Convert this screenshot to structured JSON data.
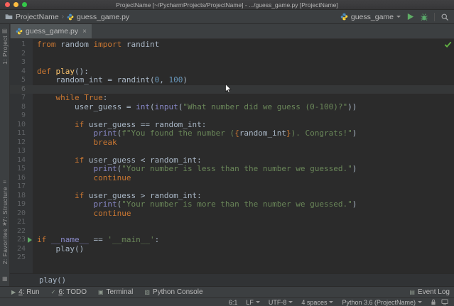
{
  "window": {
    "title": "ProjectName [~/PycharmProjects/ProjectName] - .../guess_game.py [ProjectName]"
  },
  "navbar": {
    "project": "ProjectName",
    "separator": "›",
    "file": "guess_game.py",
    "run_config": "guess_game"
  },
  "tabs": [
    {
      "label": "guess_game.py",
      "close": "×"
    }
  ],
  "left_strip": {
    "items": [
      {
        "id": "project",
        "label": "1: Project",
        "icon": "project-icon",
        "glyph": "▤"
      },
      {
        "id": "structure",
        "label": "7: Structure",
        "icon": "structure-icon",
        "glyph": "≡"
      },
      {
        "id": "favorites",
        "label": "2: Favorites",
        "icon": "favorites-icon",
        "glyph": "★"
      }
    ],
    "switcher_glyph": "▦"
  },
  "editor": {
    "caret_line": 6,
    "run_line": 23,
    "lines": [
      {
        "n": 1,
        "seg": [
          [
            "kw",
            "from"
          ],
          [
            "t",
            " random "
          ],
          [
            "kw",
            "import"
          ],
          [
            "t",
            " randint"
          ]
        ]
      },
      {
        "n": 2,
        "seg": []
      },
      {
        "n": 3,
        "seg": []
      },
      {
        "n": 4,
        "seg": [
          [
            "kw",
            "def"
          ],
          [
            "t",
            " "
          ],
          [
            "fn",
            "play"
          ],
          [
            "t",
            "():"
          ]
        ]
      },
      {
        "n": 5,
        "seg": [
          [
            "t",
            "    random_int = randint("
          ],
          [
            "nu",
            "0"
          ],
          [
            "t",
            ", "
          ],
          [
            "nu",
            "100"
          ],
          [
            "t",
            ")"
          ]
        ]
      },
      {
        "n": 6,
        "seg": []
      },
      {
        "n": 7,
        "seg": [
          [
            "t",
            "    "
          ],
          [
            "kw",
            "while"
          ],
          [
            "t",
            " "
          ],
          [
            "kw",
            "True"
          ],
          [
            "t",
            ":"
          ]
        ]
      },
      {
        "n": 8,
        "seg": [
          [
            "t",
            "        user_guess = "
          ],
          [
            "bi",
            "int"
          ],
          [
            "t",
            "("
          ],
          [
            "bi",
            "input"
          ],
          [
            "t",
            "("
          ],
          [
            "st",
            "\"What number did we guess (0-100)?\""
          ],
          [
            "t",
            "))"
          ]
        ]
      },
      {
        "n": 9,
        "seg": []
      },
      {
        "n": 10,
        "seg": [
          [
            "t",
            "        "
          ],
          [
            "kw",
            "if"
          ],
          [
            "t",
            " user_guess == random_int:"
          ]
        ]
      },
      {
        "n": 11,
        "seg": [
          [
            "t",
            "            "
          ],
          [
            "bi",
            "print"
          ],
          [
            "t",
            "("
          ],
          [
            "st",
            "f\"You found the number ("
          ],
          [
            "br",
            "{"
          ],
          [
            "t",
            "random_int"
          ],
          [
            "br",
            "}"
          ],
          [
            "st",
            "). Congrats!\""
          ],
          [
            "t",
            ")"
          ]
        ]
      },
      {
        "n": 12,
        "seg": [
          [
            "t",
            "            "
          ],
          [
            "kw",
            "break"
          ]
        ]
      },
      {
        "n": 13,
        "seg": []
      },
      {
        "n": 14,
        "seg": [
          [
            "t",
            "        "
          ],
          [
            "kw",
            "if"
          ],
          [
            "t",
            " user_guess < random_int:"
          ]
        ]
      },
      {
        "n": 15,
        "seg": [
          [
            "t",
            "            "
          ],
          [
            "bi",
            "print"
          ],
          [
            "t",
            "("
          ],
          [
            "st",
            "\"Your number is less than the number we guessed.\""
          ],
          [
            "t",
            ")"
          ]
        ]
      },
      {
        "n": 16,
        "seg": [
          [
            "t",
            "            "
          ],
          [
            "kw",
            "continue"
          ]
        ]
      },
      {
        "n": 17,
        "seg": []
      },
      {
        "n": 18,
        "seg": [
          [
            "t",
            "        "
          ],
          [
            "kw",
            "if"
          ],
          [
            "t",
            " user_guess > random_int:"
          ]
        ]
      },
      {
        "n": 19,
        "seg": [
          [
            "t",
            "            "
          ],
          [
            "bi",
            "print"
          ],
          [
            "t",
            "("
          ],
          [
            "st",
            "\"Your number is more than the number we guessed.\""
          ],
          [
            "t",
            ")"
          ]
        ]
      },
      {
        "n": 20,
        "seg": [
          [
            "t",
            "            "
          ],
          [
            "kw",
            "continue"
          ]
        ]
      },
      {
        "n": 21,
        "seg": []
      },
      {
        "n": 22,
        "seg": []
      },
      {
        "n": 23,
        "seg": [
          [
            "kw",
            "if"
          ],
          [
            "t",
            " "
          ],
          [
            "bi",
            "__name__"
          ],
          [
            "t",
            " == "
          ],
          [
            "st",
            "'__main__'"
          ],
          [
            "t",
            ":"
          ]
        ]
      },
      {
        "n": 24,
        "seg": [
          [
            "t",
            "    play()"
          ]
        ]
      },
      {
        "n": 25,
        "seg": []
      }
    ]
  },
  "breadcrumbs": {
    "context": "play()"
  },
  "toolbar": {
    "left": [
      {
        "id": "run",
        "mnemonic": "4",
        "rest": ": Run",
        "icon": "run-tool-icon",
        "glyph": "▶"
      },
      {
        "id": "todo",
        "mnemonic": "6",
        "rest": ": TODO",
        "icon": "todo-tool-icon",
        "glyph": "✓"
      },
      {
        "id": "terminal",
        "mnemonic": "",
        "rest": "Terminal",
        "icon": "terminal-tool-icon",
        "glyph": "▣"
      },
      {
        "id": "python-console",
        "mnemonic": "",
        "rest": "Python Console",
        "icon": "python-console-icon",
        "glyph": "▧"
      }
    ],
    "right": [
      {
        "id": "event-log",
        "mnemonic": "",
        "rest": "Event Log",
        "icon": "event-log-icon",
        "glyph": "▤"
      }
    ]
  },
  "statusbar": {
    "items": [
      {
        "label": "6:1",
        "caret": false
      },
      {
        "label": "LF",
        "caret": true
      },
      {
        "label": "UTF-8",
        "caret": true
      },
      {
        "label": "4 spaces",
        "caret": true
      },
      {
        "label": "Python 3.6 (ProjectName)",
        "caret": true
      }
    ]
  },
  "theme": {
    "editor_bg": "#2B2B2B",
    "panel_bg": "#3C3F41",
    "gutter_bg": "#313335",
    "caret_line_bg": "#353738",
    "keyword": "#CC7832",
    "string": "#6A8759",
    "number": "#6897BB",
    "builtin": "#8888C6",
    "function": "#FFC66D",
    "text": "#A9B7C6",
    "line_number": "#606366",
    "run_green": "#5FAD65",
    "check_green": "#62B543",
    "python_blue": "#4B8BBE",
    "python_yellow": "#FFD43B"
  }
}
